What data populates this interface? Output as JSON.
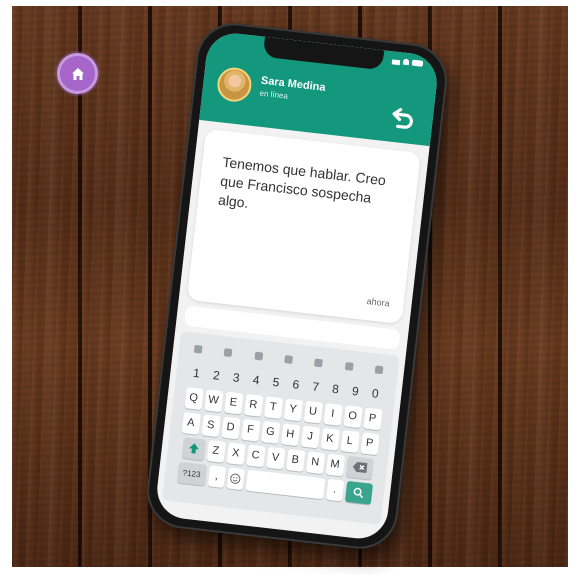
{
  "home": {
    "icon": "home-icon"
  },
  "contact": {
    "name": "Sara Medina",
    "status": "en línea"
  },
  "message": {
    "text": "Tenemos que hablar. Creo que Francisco sospecha algo.",
    "time": "ahora"
  },
  "keyboard": {
    "numbers": [
      "1",
      "2",
      "3",
      "4",
      "5",
      "6",
      "7",
      "8",
      "9",
      "0"
    ],
    "row1": [
      "Q",
      "W",
      "E",
      "R",
      "T",
      "Y",
      "U",
      "I",
      "O",
      "P"
    ],
    "row2": [
      "A",
      "S",
      "D",
      "F",
      "G",
      "H",
      "J",
      "K",
      "L",
      "P"
    ],
    "row3": [
      "Z",
      "X",
      "C",
      "V",
      "B",
      "N",
      "M"
    ],
    "symbols_label": "?123",
    "comma": ",",
    "period": ".",
    "search_icon": "search-icon"
  },
  "colors": {
    "header": "#13977d",
    "home_button": "#a565c9",
    "action_key": "#3aa58f"
  }
}
